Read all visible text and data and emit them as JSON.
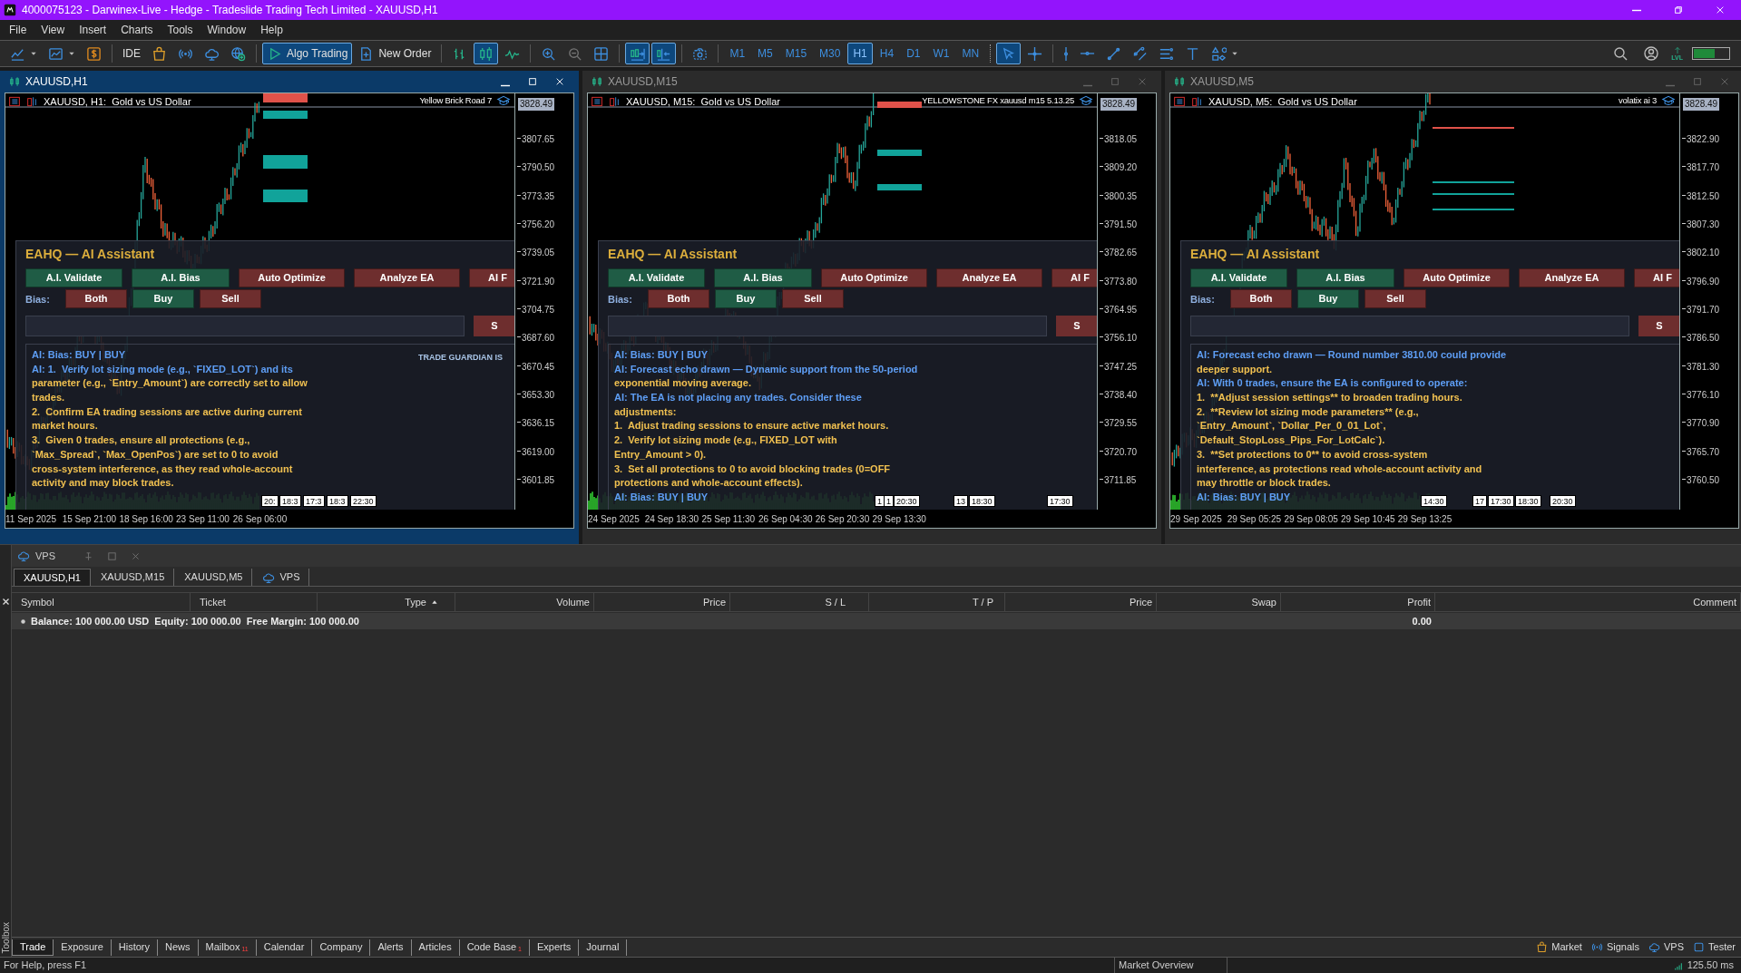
{
  "window": {
    "title": "4000075123 - Darwinex-Live - Hedge - Tradeslide Trading Tech Limited - XAUUSD,H1"
  },
  "menu": [
    "File",
    "View",
    "Insert",
    "Charts",
    "Tools",
    "Window",
    "Help"
  ],
  "toolbar": {
    "groups": [
      [
        {
          "kind": "line-chart",
          "selected": false
        },
        {
          "kind": "chart-window",
          "selected": false
        },
        {
          "kind": "dollar",
          "selected": false
        }
      ],
      [
        {
          "kind": "text",
          "label": "IDE",
          "selected": false
        },
        {
          "kind": "bag",
          "selected": false
        },
        {
          "kind": "broadcast",
          "selected": false
        },
        {
          "kind": "cloud",
          "selected": false
        },
        {
          "kind": "globe-plus",
          "selected": false
        }
      ],
      [
        {
          "kind": "play",
          "label": "Algo Trading",
          "selected": true
        },
        {
          "kind": "document-plus",
          "label": "New Order",
          "selected": false
        }
      ],
      [
        {
          "kind": "bar-chart",
          "selected": false
        },
        {
          "kind": "candlestick",
          "selected": true
        },
        {
          "kind": "line-wave",
          "selected": false
        }
      ],
      [
        {
          "kind": "zoom-in",
          "selected": false
        },
        {
          "kind": "zoom-out",
          "selected": false
        },
        {
          "kind": "grid",
          "selected": false
        }
      ],
      [
        {
          "kind": "autoscroll",
          "selected": true
        },
        {
          "kind": "chart-shift",
          "selected": true
        }
      ],
      [
        {
          "kind": "camera",
          "selected": false
        }
      ]
    ],
    "timeframes": [
      {
        "label": "M1",
        "selected": false
      },
      {
        "label": "M5",
        "selected": false
      },
      {
        "label": "M15",
        "selected": false
      },
      {
        "label": "M30",
        "selected": false
      },
      {
        "label": "H1",
        "selected": true
      },
      {
        "label": "H4",
        "selected": false
      },
      {
        "label": "D1",
        "selected": false
      },
      {
        "label": "W1",
        "selected": false
      },
      {
        "label": "MN",
        "selected": false
      }
    ],
    "tool_groups": [
      [
        {
          "kind": "cursor",
          "selected": true
        },
        {
          "kind": "crosshair",
          "selected": false
        }
      ],
      [
        {
          "kind": "vertical-line",
          "selected": false
        },
        {
          "kind": "horizontal-line",
          "selected": false
        },
        {
          "kind": "trend-line",
          "selected": false
        },
        {
          "kind": "parallel-lines",
          "selected": false
        },
        {
          "kind": "fibonacci",
          "selected": false
        },
        {
          "kind": "text-tool",
          "selected": false
        },
        {
          "kind": "shapes",
          "selected": false
        }
      ]
    ],
    "right": [
      {
        "kind": "search"
      },
      {
        "kind": "account"
      },
      {
        "kind": "level-up",
        "label": "LVL"
      },
      {
        "kind": "battery"
      }
    ]
  },
  "charts": [
    {
      "title": "XAUUSD,H1",
      "active": true,
      "caption": "XAUUSD, H1:  Gold vs US Dollar",
      "ea_name": "Yellow Brick Road 7",
      "price_tag": "3828.49",
      "prices": [
        "3807.65",
        "3790.50",
        "3773.35",
        "3756.20",
        "3739.05",
        "3721.90",
        "3704.75",
        "3687.60",
        "3670.45",
        "3653.30",
        "3636.15",
        "3619.00",
        "3601.85"
      ],
      "times": [
        "11 Sep 2025",
        "15 Sep 21:00",
        "18 Sep 16:00",
        "23 Sep 11:00",
        "26 Sep 06:00"
      ],
      "markers": [
        "20:",
        "18:3",
        "17:3",
        "18:3",
        "22:30"
      ],
      "panel": {
        "title": "EAHQ — AI Assistant",
        "actions": [
          {
            "label": "A.I. Validate",
            "color": "#1f5c45"
          },
          {
            "label": "A.I. Bias",
            "color": "#1f5c45"
          },
          {
            "label": "Auto Optimize",
            "color": "#6e2e2e"
          },
          {
            "label": "Analyze EA",
            "color": "#6e2e2e"
          },
          {
            "label": "AI F",
            "color": "#6e2e2e"
          }
        ],
        "bias_label": "Bias:",
        "bias": [
          {
            "label": "Both",
            "color": "#6e2e2e"
          },
          {
            "label": "Buy",
            "color": "#1f5c45"
          },
          {
            "label": "Sell",
            "color": "#6e2e2e"
          }
        ],
        "send": {
          "label": "S",
          "color": "#6e2e2e"
        },
        "note": "TRADE GUARDIAN IS",
        "messages": [
          {
            "kind": "ai",
            "text": "AI: Bias: BUY | BUY"
          },
          {
            "kind": "ai",
            "text": "AI: 1.  Verify lot sizing mode (e.g., `FIXED_LOT`) and its"
          },
          {
            "kind": "text",
            "text": "parameter (e.g., `Entry_Amount`) are correctly set to allow"
          },
          {
            "kind": "text",
            "text": "trades."
          },
          {
            "kind": "text",
            "text": "2.  Confirm EA trading sessions are active during current"
          },
          {
            "kind": "text",
            "text": "market hours."
          },
          {
            "kind": "text",
            "text": "3.  Given 0 trades, ensure all protections (e.g.,"
          },
          {
            "kind": "text",
            "text": "`Max_Spread`, `Max_OpenPos`) are set to 0 to avoid"
          },
          {
            "kind": "text",
            "text": "cross-system interference, as they read whole-account"
          },
          {
            "kind": "text",
            "text": "activity and may block trades."
          }
        ]
      }
    },
    {
      "title": "XAUUSD,M15",
      "active": false,
      "caption": "XAUUSD, M15:  Gold vs US Dollar",
      "ea_name": "YELLOWSTONE FX xauusd m15 5.13.25",
      "price_tag": "3828.49",
      "prices": [
        "3818.05",
        "3809.20",
        "3800.35",
        "3791.50",
        "3782.65",
        "3773.80",
        "3764.95",
        "3756.10",
        "3747.25",
        "3738.40",
        "3729.55",
        "3720.70",
        "3711.85"
      ],
      "times": [
        "24 Sep 2025",
        "24 Sep 18:30",
        "25 Sep 11:30",
        "26 Sep 04:30",
        "26 Sep 20:30",
        "29 Sep 13:30"
      ],
      "markers": [
        "1",
        "1",
        "20:30",
        "13",
        "18:30",
        "17:30"
      ],
      "panel": {
        "title": "EAHQ — AI Assistant",
        "actions": [
          {
            "label": "A.I. Validate",
            "color": "#1f5c45"
          },
          {
            "label": "A.I. Bias",
            "color": "#1f5c45"
          },
          {
            "label": "Auto Optimize",
            "color": "#6e2e2e"
          },
          {
            "label": "Analyze EA",
            "color": "#6e2e2e"
          },
          {
            "label": "AI F",
            "color": "#6e2e2e"
          }
        ],
        "bias_label": "Bias:",
        "bias": [
          {
            "label": "Both",
            "color": "#6e2e2e"
          },
          {
            "label": "Buy",
            "color": "#1f5c45"
          },
          {
            "label": "Sell",
            "color": "#6e2e2e"
          }
        ],
        "send": {
          "label": "S",
          "color": "#6e2e2e"
        },
        "messages": [
          {
            "kind": "ai",
            "text": "AI: Bias: BUY | BUY"
          },
          {
            "kind": "ai",
            "text": "AI: Forecast echo drawn — Dynamic support from the 50-period"
          },
          {
            "kind": "text",
            "text": "exponential moving average."
          },
          {
            "kind": "ai",
            "text": "AI: The EA is not placing any trades. Consider these"
          },
          {
            "kind": "text",
            "text": "adjustments:"
          },
          {
            "kind": "text",
            "text": "1.  Adjust trading sessions to ensure active market hours."
          },
          {
            "kind": "text",
            "text": "2.  Verify lot sizing mode (e.g., FIXED_LOT with"
          },
          {
            "kind": "text",
            "text": "Entry_Amount > 0)."
          },
          {
            "kind": "text",
            "text": "3.  Set all protections to 0 to avoid blocking trades (0=OFF"
          },
          {
            "kind": "text",
            "text": "protections and whole-account effects)."
          },
          {
            "kind": "ai",
            "text": "AI: Bias: BUY | BUY"
          }
        ]
      }
    },
    {
      "title": "XAUUSD,M5",
      "active": false,
      "caption": "XAUUSD, M5:  Gold vs US Dollar",
      "ea_name": "volatix ai 3",
      "price_tag": "3828.49",
      "prices": [
        "3822.90",
        "3817.70",
        "3812.50",
        "3807.30",
        "3802.10",
        "3796.90",
        "3791.70",
        "3786.50",
        "3781.30",
        "3776.10",
        "3770.90",
        "3765.70",
        "3760.50"
      ],
      "times": [
        "29 Sep 2025",
        "29 Sep 05:25",
        "29 Sep 08:05",
        "29 Sep 10:45",
        "29 Sep 13:25"
      ],
      "markers": [
        "14:30",
        "17",
        "17:30",
        "18:30",
        "20:30"
      ],
      "panel": {
        "title": "EAHQ — AI Assistant",
        "actions": [
          {
            "label": "A.I. Validate",
            "color": "#1f5c45"
          },
          {
            "label": "A.I. Bias",
            "color": "#1f5c45"
          },
          {
            "label": "Auto Optimize",
            "color": "#6e2e2e"
          },
          {
            "label": "Analyze EA",
            "color": "#6e2e2e"
          },
          {
            "label": "AI F",
            "color": "#6e2e2e"
          }
        ],
        "bias_label": "Bias:",
        "bias": [
          {
            "label": "Both",
            "color": "#6e2e2e"
          },
          {
            "label": "Buy",
            "color": "#1f5c45"
          },
          {
            "label": "Sell",
            "color": "#6e2e2e"
          }
        ],
        "send": {
          "label": "S",
          "color": "#6e2e2e"
        },
        "messages": [
          {
            "kind": "ai",
            "text": "AI: Forecast echo drawn — Round number 3810.00 could provide"
          },
          {
            "kind": "text",
            "text": "deeper support."
          },
          {
            "kind": "ai",
            "text": "AI: With 0 trades, ensure the EA is configured to operate:"
          },
          {
            "kind": "text",
            "text": "1.  **Adjust session settings** to broaden trading hours."
          },
          {
            "kind": "text",
            "text": "2.  **Review lot sizing mode parameters** (e.g.,"
          },
          {
            "kind": "text",
            "text": "`Entry_Amount`, `Dollar_Per_0_01_Lot`,"
          },
          {
            "kind": "text",
            "text": "`Default_StopLoss_Pips_For_LotCalc`)."
          },
          {
            "kind": "text",
            "text": "3.  **Set protections to 0** to avoid cross-system"
          },
          {
            "kind": "text",
            "text": "interference, as protections read whole-account activity and"
          },
          {
            "kind": "text",
            "text": "may throttle or block trades."
          },
          {
            "kind": "ai",
            "text": "AI: Bias: BUY | BUY"
          }
        ]
      }
    }
  ],
  "vps_panel": {
    "title": "VPS",
    "tabs": [
      {
        "label": "XAUUSD,H1",
        "selected": true,
        "kind": "chart"
      },
      {
        "label": "XAUUSD,M15",
        "selected": false,
        "kind": "chart"
      },
      {
        "label": "XAUUSD,M5",
        "selected": false,
        "kind": "chart"
      },
      {
        "label": "VPS",
        "selected": false,
        "kind": "vps"
      }
    ]
  },
  "table": {
    "columns": [
      {
        "label": "Symbol",
        "sorted": false
      },
      {
        "label": "Ticket",
        "sorted": false
      },
      {
        "label": "Type",
        "sorted": true
      },
      {
        "label": "Volume",
        "sorted": false
      },
      {
        "label": "Price",
        "sorted": false
      },
      {
        "label": "S / L",
        "sorted": false
      },
      {
        "label": "T / P",
        "sorted": false
      },
      {
        "label": "Price",
        "sorted": false
      },
      {
        "label": "Swap",
        "sorted": false
      },
      {
        "label": "Profit",
        "sorted": false
      },
      {
        "label": "Comment",
        "sorted": false
      }
    ],
    "summary": {
      "text": "Balance: 100 000.00 USD  Equity: 100 000.00  Free Margin: 100 000.00",
      "profit": "0.00"
    }
  },
  "toolbox": {
    "label": "Toolbox",
    "tabs": [
      {
        "label": "Trade",
        "selected": true
      },
      {
        "label": "Exposure",
        "selected": false
      },
      {
        "label": "History",
        "selected": false
      },
      {
        "label": "News",
        "selected": false
      },
      {
        "label": "Mailbox",
        "selected": false,
        "badge": "11"
      },
      {
        "label": "Calendar",
        "selected": false
      },
      {
        "label": "Company",
        "selected": false
      },
      {
        "label": "Alerts",
        "selected": false
      },
      {
        "label": "Articles",
        "selected": false
      },
      {
        "label": "Code Base",
        "selected": false,
        "badge": "1"
      },
      {
        "label": "Experts",
        "selected": false
      },
      {
        "label": "Journal",
        "selected": false
      }
    ],
    "links": [
      {
        "kind": "bag",
        "label": "Market"
      },
      {
        "kind": "broadcast",
        "label": "Signals"
      },
      {
        "kind": "cloud",
        "label": "VPS"
      },
      {
        "kind": "tester",
        "label": "Tester"
      }
    ]
  },
  "status_bar": {
    "help": "For Help, press F1",
    "panel": "Market Overview",
    "ping": "125.50 ms"
  }
}
